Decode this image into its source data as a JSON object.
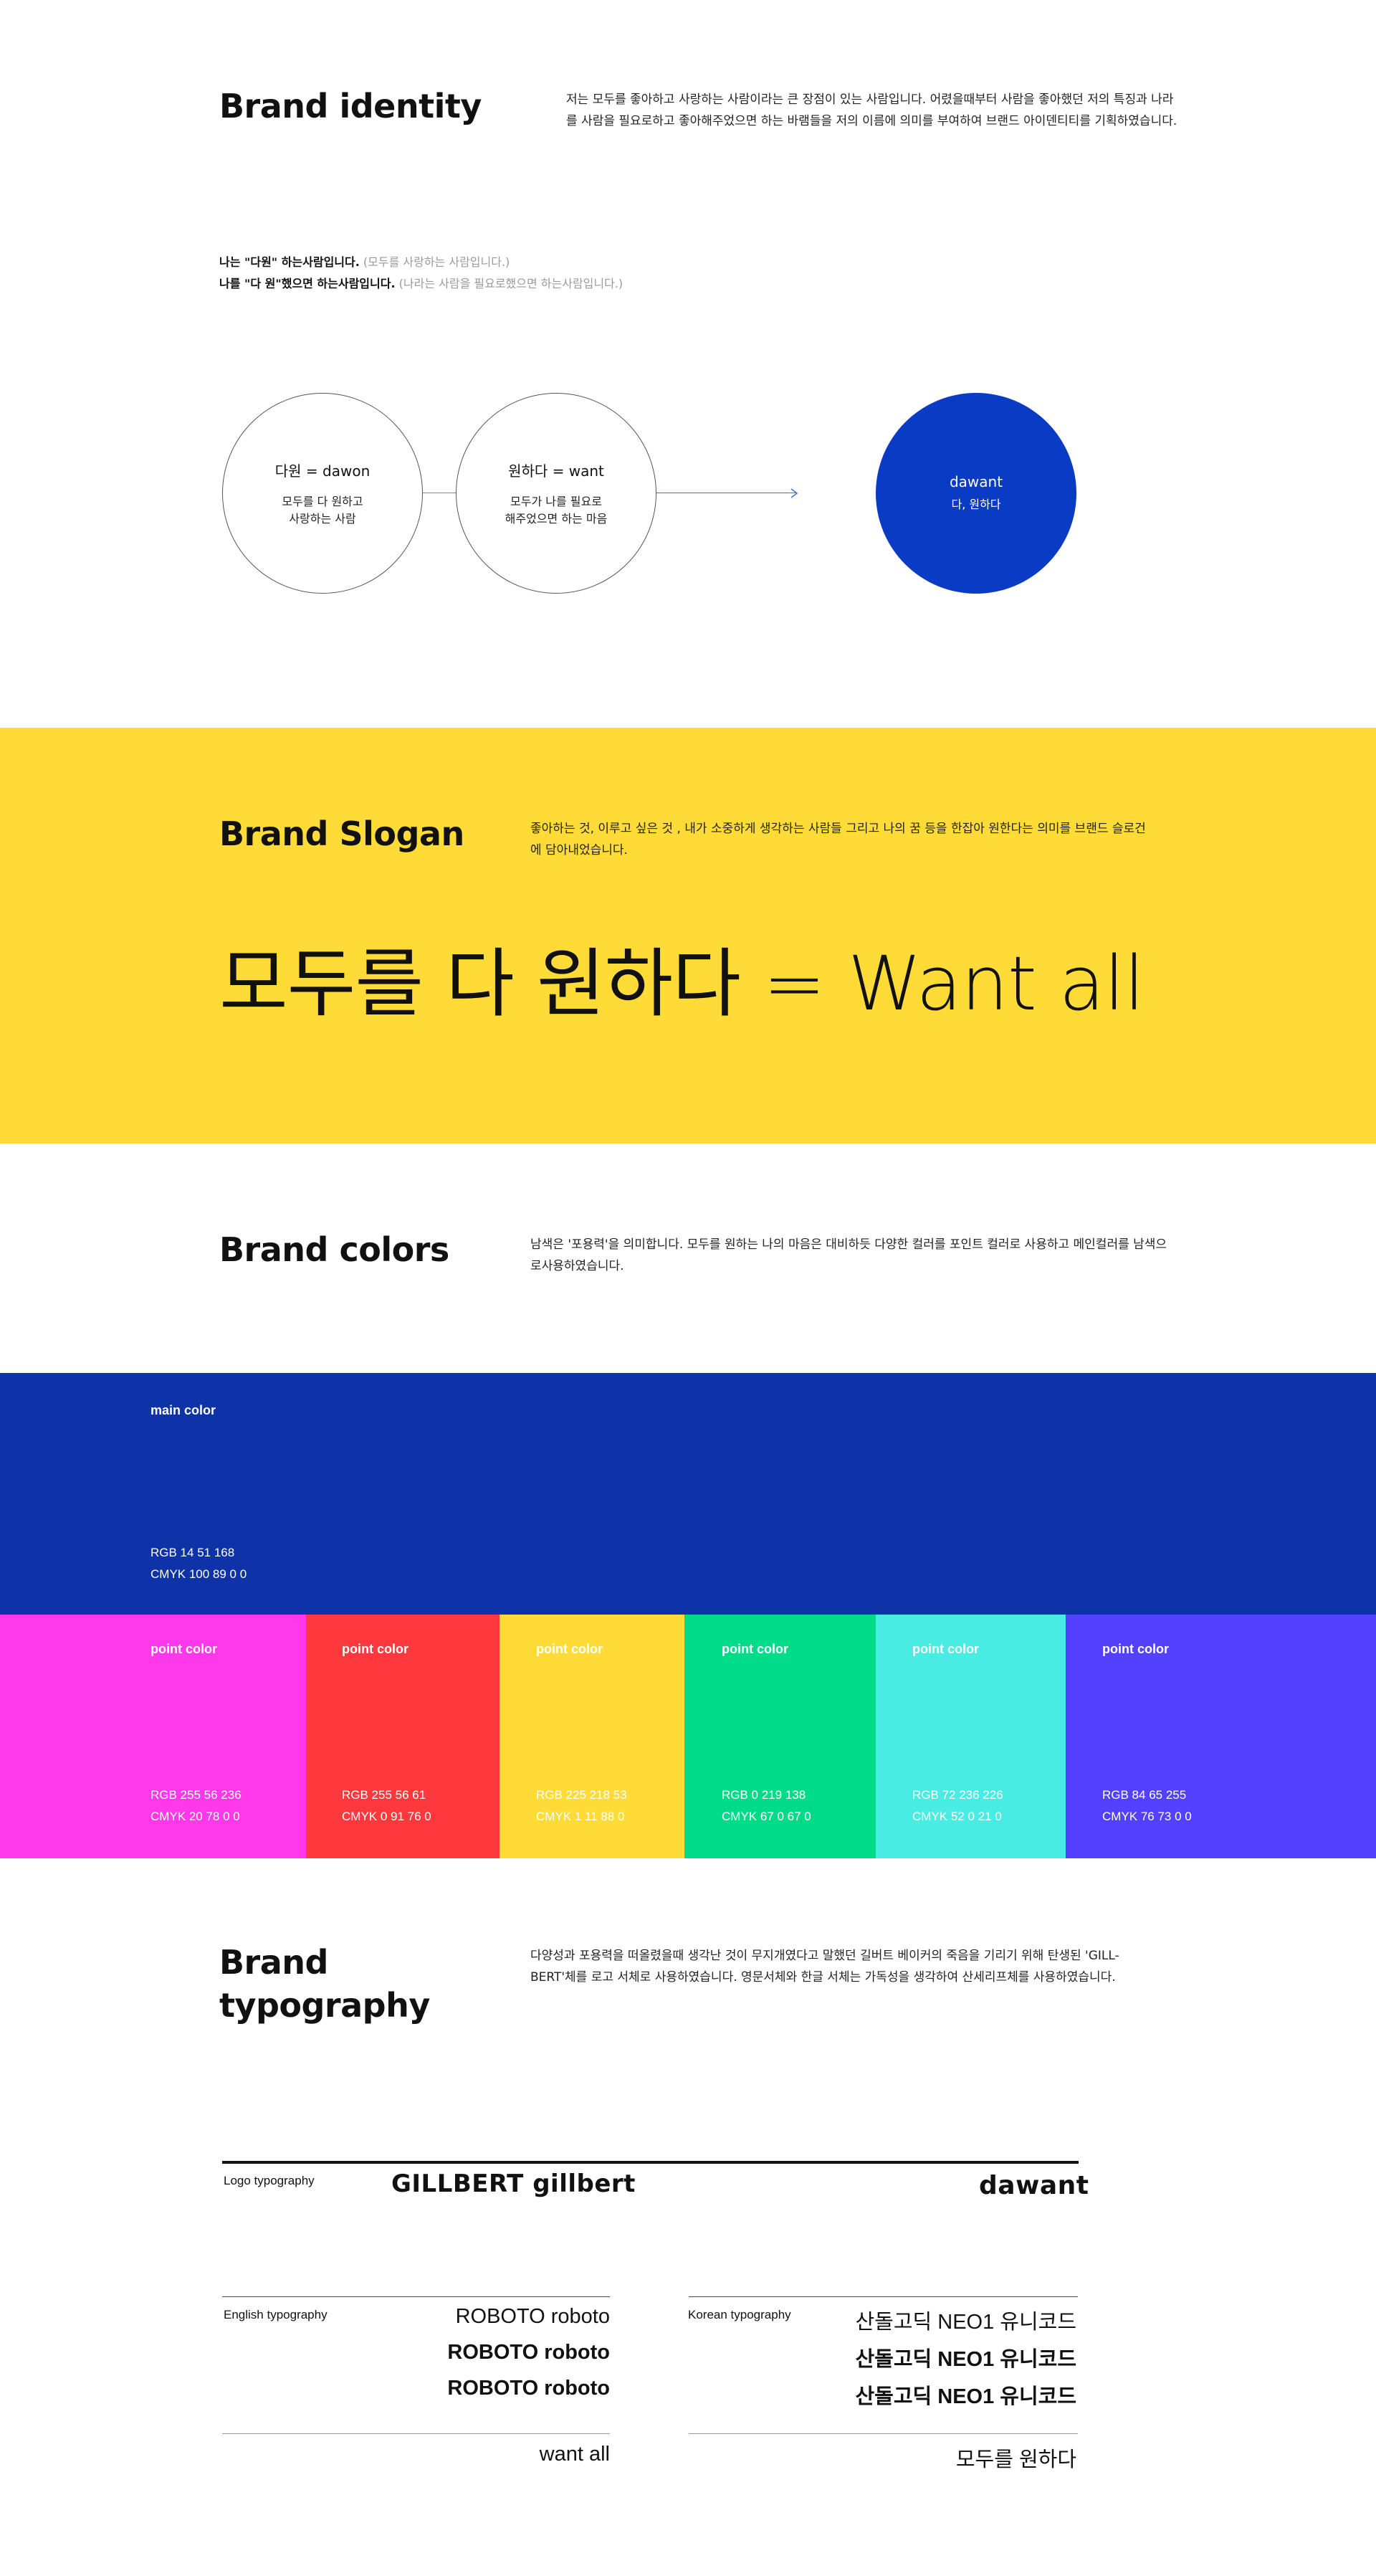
{
  "identity": {
    "title": "Brand identity",
    "description": "저는 모두를 좋아하고 사랑하는 사람이라는 큰 장점이 있는 사람입니다. 어렸을때부터 사람을 좋아했던 저의 특징과 나라를 사람을 필요로하고 좋아해주었으면 하는 바램들을 저의 이름에 의미를 부여하여 브랜드 아이덴티티를 기획하였습니다.",
    "line1_bold": "나는 \"다원\" 하는사람입니다.",
    "line1_muted": "(모두를 사랑하는 사람입니다.)",
    "line2_bold": "나를 \"다 원\"했으면 하는사람입니다.",
    "line2_muted": "(나라는 사람을 필요로했으면 하는사람입니다.)",
    "circles": [
      {
        "title": "다원 = dawon",
        "desc1": "모두를 다 원하고",
        "desc2": "사랑하는 사람"
      },
      {
        "title": "원하다 = want",
        "desc1": "모두가 나를 필요로",
        "desc2": "해주었으면 하는 마음"
      },
      {
        "title": "dawant",
        "desc1": "다, 원하다",
        "desc2": ""
      }
    ]
  },
  "slogan": {
    "title": "Brand Slogan",
    "description": "좋아하는 것, 이루고 싶은 것 , 내가 소중하게 생각하는 사람들 그리고 나의 꿈 등을 한잡아 원한다는 의미를 브랜드 슬로건에 담아내었습니다.",
    "text": "모두를 다 원하다 = Want all"
  },
  "colors": {
    "title": "Brand colors",
    "description": "남색은 '포용력'을 의미합니다. 모두를 원하는 나의 마음은 대비하듯 다양한 컬러를 포인트 컬러로 사용하고 메인컬러를 남색으로사용하였습니다.",
    "main": {
      "label": "main color",
      "rgb": "RGB 14 51 168",
      "cmyk": "CMYK 100 89 0 0",
      "hex": "#0e33a8"
    },
    "points": [
      {
        "label": "point color",
        "rgb": "RGB 255 56 236",
        "cmyk": "CMYK 20 78 0 0",
        "hex": "#ff38ec"
      },
      {
        "label": "point color",
        "rgb": "RGB 255 56 61",
        "cmyk": "CMYK 0 91 76 0",
        "hex": "#ff383d"
      },
      {
        "label": "point color",
        "rgb": "RGB 225 218 53",
        "cmyk": "CMYK 1 11 88 0",
        "hex": "#fedb37"
      },
      {
        "label": "point color",
        "rgb": "RGB 0 219 138",
        "cmyk": "CMYK 67 0 67 0",
        "hex": "#00db8a"
      },
      {
        "label": "point color",
        "rgb": "RGB 72 236 226",
        "cmyk": "CMYK 52 0 21 0",
        "hex": "#48ece2"
      },
      {
        "label": "point color",
        "rgb": "RGB 84 65 255",
        "cmyk": "CMYK 76 73 0 0",
        "hex": "#5441ff"
      }
    ]
  },
  "typography": {
    "title_line1": "Brand",
    "title_line2": "typography",
    "description": "다양성과 포용력을 떠올렸을때 생각난 것이 무지개였다고 말했던 길버트 베이커의 죽음을 기리기 위해 탄생된 'GILL-BERT'체를 로고 서체로 사용하였습니다. 영문서체와 한글 서체는 가독성을 생각하여 산세리프체를 사용하였습니다.",
    "logo_label": "Logo typography",
    "logo_sample": "GILLBERT gillbert",
    "logo_word": "dawant",
    "english_label": "English typography",
    "english_samples": [
      "ROBOTO roboto",
      "ROBOTO roboto",
      "ROBOTO roboto"
    ],
    "english_example": "want all",
    "korean_label": "Korean typography",
    "korean_samples": [
      "산돌고딕 NEO1 유니코드",
      "산돌고딕 NEO1 유니코드",
      "산돌고딕 NEO1 유니코드"
    ],
    "korean_example": "모두를 원하다"
  }
}
